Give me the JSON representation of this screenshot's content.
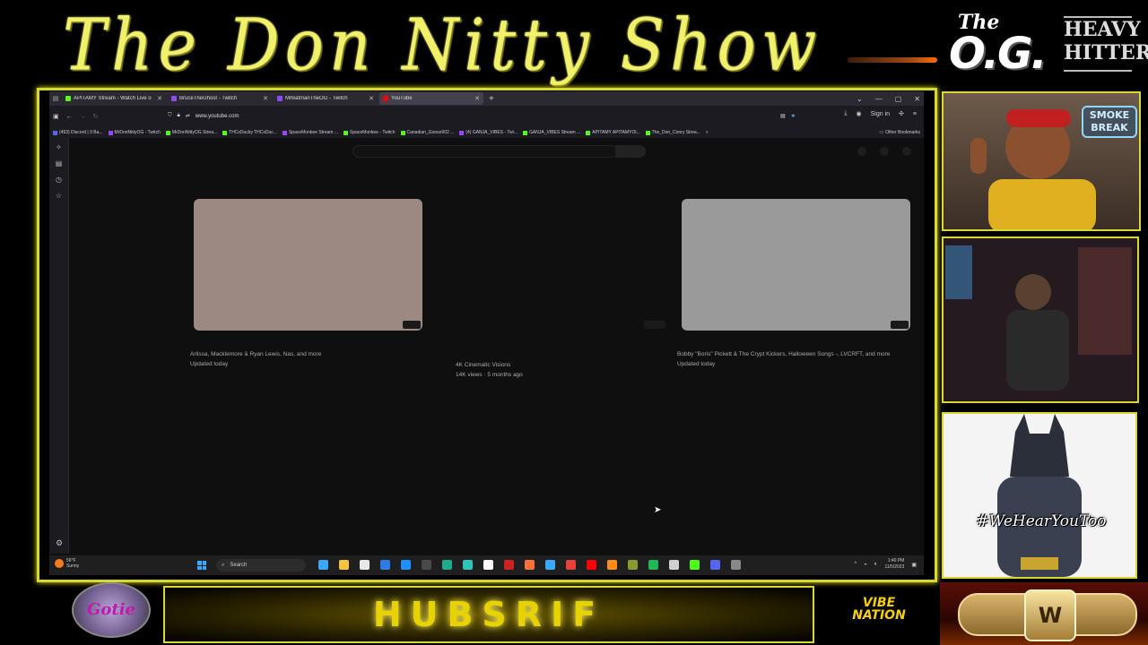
{
  "overlay": {
    "show_title": "The Don Nitty Show",
    "og_logo_the": "The",
    "og_logo_og": "O.G.",
    "heavy_hitters": "HEAVY HITTERS",
    "smoke_break": "SMOKE BREAK",
    "we_hear": "#WeHearYouToo",
    "banner_text": "HUBSRIF",
    "vibe_nation": "VIBE NATION",
    "round_logo": "Gotie",
    "belt_plate": "W"
  },
  "browser": {
    "tabs": [
      {
        "label": "APITAMY Stream - Watch Live o",
        "favicon_color": "#53fc18"
      },
      {
        "label": "BruceTheGhost - Twitch",
        "favicon_color": "#9146ff"
      },
      {
        "label": "MrBatmanTheOG - Twitch",
        "favicon_color": "#9146ff"
      },
      {
        "label": "YouTube",
        "favicon_color": "#ff0000"
      }
    ],
    "active_tab": 3,
    "url": "www.youtube.com",
    "sign_in": "Sign in",
    "bookmarks": [
      "(463) Discord | 9 Ba...",
      "MrDonNittyOG - Twitch",
      "MrDonNittyOG Strea...",
      "THCxDucky THCxDuc...",
      "SpaceMonkee Stream ...",
      "SpaceMonkee - Twitch",
      "Canadian_Goose902 ...",
      "(4) GANJA_VIBES - Twi...",
      "GANJA_VIBES Stream ...",
      "APITAMY APITAMYOl...",
      "The_Don_Conry Strea..."
    ],
    "other_bookmarks": "Other Bookmarks"
  },
  "youtube": {
    "cards": [
      {
        "line1": "Arlissa, Macklemore & Ryan Lewis, Nas, and more",
        "line2": "Updated today",
        "thumb_color": "#9c8a82"
      },
      {
        "line1": "4K Cinematic Visions",
        "line2": "14K views · 5 months ago",
        "thumb_color": "#0f0f0f"
      },
      {
        "line1": "Bobby \"Boris\" Pickett & The Crypt Kickers, Halloween Songs -, LVCRFT, and more",
        "line2": "Updated today",
        "thumb_color": "#9a9a9a"
      }
    ]
  },
  "taskbar": {
    "weather_temp": "56°F",
    "weather_desc": "Sunny",
    "search_label": "Search",
    "time": "1:40 PM",
    "date": "11/5/2023",
    "app_colors": [
      "#3ba7ff",
      "#f5c242",
      "#e8e8e8",
      "#2d7be3",
      "#1e90ff",
      "#4a4a4a",
      "#1faa8e",
      "#2ec4b6",
      "#ffffff",
      "#cc2222",
      "#ff7139",
      "#3ba7ff",
      "#e8413a",
      "#ff0000",
      "#ff8c1a",
      "#8a9a2e",
      "#1db954",
      "#d0d0d0",
      "#53fc18",
      "#5865f2",
      "#888888"
    ]
  }
}
